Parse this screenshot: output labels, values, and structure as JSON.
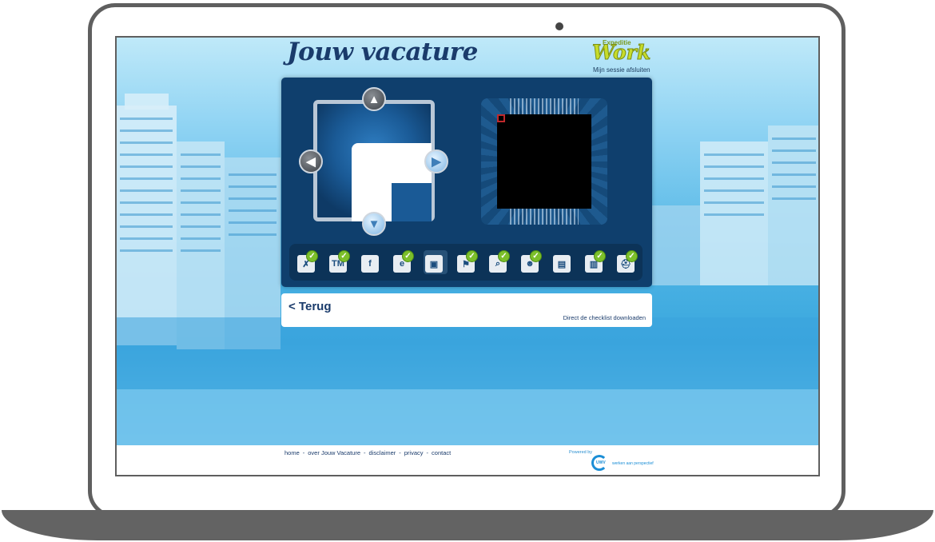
{
  "header": {
    "title": "Jouw vacature",
    "logo_small": "Expeditie",
    "logo_big": "Work",
    "session_link": "Mijn sessie afsluiten"
  },
  "puzzle": {
    "nav": {
      "up": "▲",
      "down": "▼",
      "left": "◀",
      "right": "▶"
    }
  },
  "toolbar": {
    "tools": [
      {
        "name": "tool-1",
        "glyph": "✗",
        "checked": true
      },
      {
        "name": "tool-2",
        "glyph": "TM",
        "checked": true
      },
      {
        "name": "tool-3",
        "glyph": "f",
        "checked": false
      },
      {
        "name": "tool-4",
        "glyph": "e",
        "checked": true
      },
      {
        "name": "tool-5",
        "glyph": "▣",
        "checked": false
      },
      {
        "name": "tool-6",
        "glyph": "⚑",
        "checked": true
      },
      {
        "name": "tool-7",
        "glyph": "⌕",
        "checked": true
      },
      {
        "name": "tool-8",
        "glyph": "☻",
        "checked": true
      },
      {
        "name": "tool-9",
        "glyph": "▤",
        "checked": false
      },
      {
        "name": "tool-10",
        "glyph": "▥",
        "checked": true
      },
      {
        "name": "tool-11",
        "glyph": "⛑",
        "checked": true
      }
    ]
  },
  "backbar": {
    "back_label": "< Terug",
    "download_label": "Direct de checklist downloaden"
  },
  "footer": {
    "links": [
      "home",
      "over Jouw Vacature",
      "disclaimer",
      "privacy",
      "contact"
    ],
    "separator": "-",
    "powered_by": "Powered by",
    "uwv_name": "UWV",
    "uwv_slogan": "werken aan perspectief"
  },
  "colors": {
    "panel": "#0f3f6d",
    "title": "#1a3b6b",
    "accent_green": "#7cbf2a",
    "sky": "#3aa7de"
  }
}
